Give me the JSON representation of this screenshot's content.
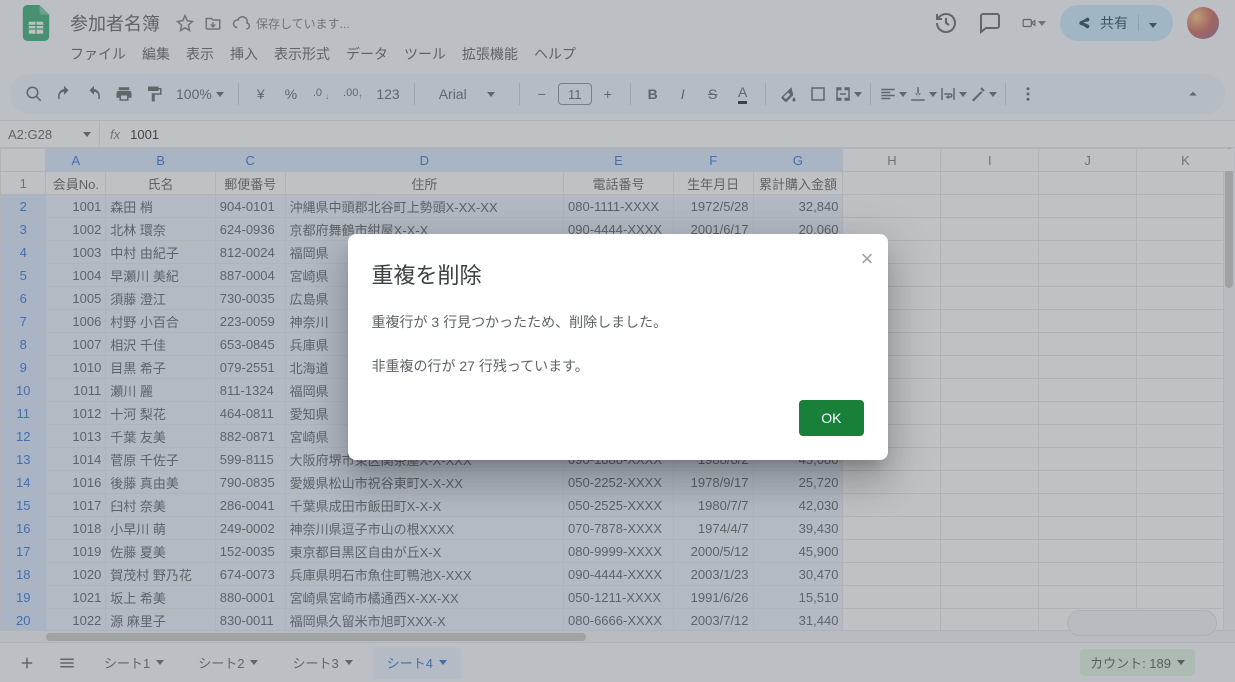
{
  "header": {
    "doc_title": "参加者名簿",
    "saving_text": "保存しています...",
    "share_label": "共有"
  },
  "menu": {
    "items": [
      "ファイル",
      "編集",
      "表示",
      "挿入",
      "表示形式",
      "データ",
      "ツール",
      "拡張機能",
      "ヘルプ"
    ]
  },
  "toolbar": {
    "zoom": "100%",
    "currency": "¥",
    "percent": "%",
    "dec_dec": ".0",
    "inc_dec": ".00",
    "num123": "123",
    "font": "Arial",
    "font_size": "11"
  },
  "namebox": "A2:G28",
  "fx_value": "1001",
  "columns_letters": [
    "A",
    "B",
    "C",
    "D",
    "E",
    "F",
    "G",
    "H",
    "I",
    "J",
    "K"
  ],
  "headers": [
    "会員No.",
    "氏名",
    "郵便番号",
    "住所",
    "電話番号",
    "生年月日",
    "累計購入金額"
  ],
  "rows": [
    {
      "r": 2,
      "a": "1001",
      "b": "森田 梢",
      "c": "904-0101",
      "d": "沖縄県中頭郡北谷町上勢頭X-XX-XX",
      "e": "080-1111-XXXX",
      "f": "1972/5/28",
      "g": "32,840"
    },
    {
      "r": 3,
      "a": "1002",
      "b": "北林 環奈",
      "c": "624-0936",
      "d": "京都府舞鶴市紺屋X-X-X",
      "e": "090-4444-XXXX",
      "f": "2001/6/17",
      "g": "20,060"
    },
    {
      "r": 4,
      "a": "1003",
      "b": "中村 由紀子",
      "c": "812-0024",
      "d": "福岡県",
      "e": "",
      "f": "",
      "g": ""
    },
    {
      "r": 5,
      "a": "1004",
      "b": "早瀬川 美紀",
      "c": "887-0004",
      "d": "宮崎県",
      "e": "",
      "f": "",
      "g": ""
    },
    {
      "r": 6,
      "a": "1005",
      "b": "須藤 澄江",
      "c": "730-0035",
      "d": "広島県",
      "e": "",
      "f": "",
      "g": ""
    },
    {
      "r": 7,
      "a": "1006",
      "b": "村野 小百合",
      "c": "223-0059",
      "d": "神奈川",
      "e": "",
      "f": "",
      "g": ""
    },
    {
      "r": 8,
      "a": "1007",
      "b": "相沢 千佳",
      "c": "653-0845",
      "d": "兵庫県",
      "e": "",
      "f": "",
      "g": ""
    },
    {
      "r": 9,
      "a": "1010",
      "b": "目黒 希子",
      "c": "079-2551",
      "d": "北海道",
      "e": "",
      "f": "",
      "g": ""
    },
    {
      "r": 10,
      "a": "1011",
      "b": "瀬川 麗",
      "c": "811-1324",
      "d": "福岡県",
      "e": "",
      "f": "",
      "g": ""
    },
    {
      "r": 11,
      "a": "1012",
      "b": "十河 梨花",
      "c": "464-0811",
      "d": "愛知県",
      "e": "",
      "f": "",
      "g": ""
    },
    {
      "r": 12,
      "a": "1013",
      "b": "千葉 友美",
      "c": "882-0871",
      "d": "宮崎県",
      "e": "",
      "f": "",
      "g": ""
    },
    {
      "r": 13,
      "a": "1014",
      "b": "菅原 千佐子",
      "c": "599-8115",
      "d": "大阪府堺市東区関茶屋X-X-XXX",
      "e": "090-1888-XXXX",
      "f": "1988/8/2",
      "g": "45,080"
    },
    {
      "r": 14,
      "a": "1016",
      "b": "後藤 真由美",
      "c": "790-0835",
      "d": "愛媛県松山市祝谷東町X-X-XX",
      "e": "050-2252-XXXX",
      "f": "1978/9/17",
      "g": "25,720"
    },
    {
      "r": 15,
      "a": "1017",
      "b": "臼村 奈美",
      "c": "286-0041",
      "d": "千葉県成田市飯田町X-X-X",
      "e": "050-2525-XXXX",
      "f": "1980/7/7",
      "g": "42,030"
    },
    {
      "r": 16,
      "a": "1018",
      "b": "小早川 萌",
      "c": "249-0002",
      "d": "神奈川県逗子市山の根XXXX",
      "e": "070-7878-XXXX",
      "f": "1974/4/7",
      "g": "39,430"
    },
    {
      "r": 17,
      "a": "1019",
      "b": "佐藤 夏美",
      "c": "152-0035",
      "d": "東京都目黒区自由が丘X-X",
      "e": "080-9999-XXXX",
      "f": "2000/5/12",
      "g": "45,900"
    },
    {
      "r": 18,
      "a": "1020",
      "b": "賀茂村 野乃花",
      "c": "674-0073",
      "d": "兵庫県明石市魚住町鴨池X-XXX",
      "e": "090-4444-XXXX",
      "f": "2003/1/23",
      "g": "30,470"
    },
    {
      "r": 19,
      "a": "1021",
      "b": "坂上 希美",
      "c": "880-0001",
      "d": "宮崎県宮崎市橘通西X-XX-XX",
      "e": "050-1211-XXXX",
      "f": "1991/6/26",
      "g": "15,510"
    },
    {
      "r": 20,
      "a": "1022",
      "b": "源 麻里子",
      "c": "830-0011",
      "d": "福岡県久留米市旭町XXX-X",
      "e": "080-6666-XXXX",
      "f": "2003/7/12",
      "g": "31,440"
    }
  ],
  "dialog": {
    "title": "重複を削除",
    "line1": "重複行が 3 行見つかったため、削除しました。",
    "line2": "非重複の行が 27 行残っています。",
    "ok": "OK"
  },
  "tabs": {
    "items": [
      "シート1",
      "シート2",
      "シート3",
      "シート4"
    ],
    "active_index": 3,
    "count_label": "カウント: 189"
  }
}
